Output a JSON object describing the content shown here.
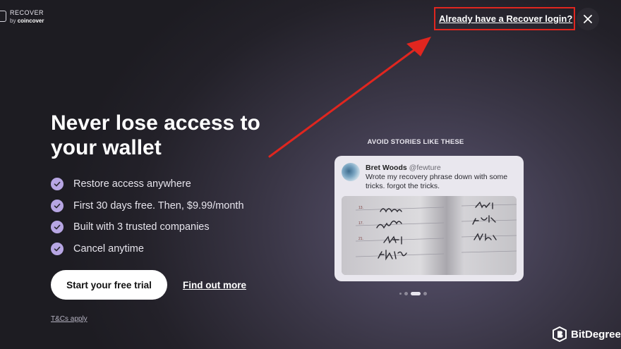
{
  "header": {
    "logo_title": "RECOVER",
    "logo_by": "by",
    "logo_company": "coincover",
    "login_link": "Already have a Recover login?",
    "close_icon": "close-icon"
  },
  "hero": {
    "headline": "Never lose access to your wallet",
    "features": [
      "Restore access anywhere",
      "First 30 days free. Then, $9.99/month",
      "Built with 3 trusted companies",
      "Cancel anytime"
    ],
    "cta_label": "Start your free trial",
    "secondary_link": "Find out more",
    "terms": "T&Cs apply"
  },
  "stories": {
    "label": "AVOID STORIES LIKE THESE",
    "tweet": {
      "name": "Bret Woods",
      "handle": "@fewture",
      "text": "Wrote my recovery phrase down with some tricks. forgot the tricks.",
      "image": "notebook-photo"
    },
    "carousel": {
      "count": 5,
      "active_index": 2
    }
  },
  "watermark": {
    "brand": "BitDegree"
  },
  "colors": {
    "accent_check": "#b7a6e3",
    "annotation_red": "#e0261f",
    "background_dark": "#1d1c22"
  }
}
